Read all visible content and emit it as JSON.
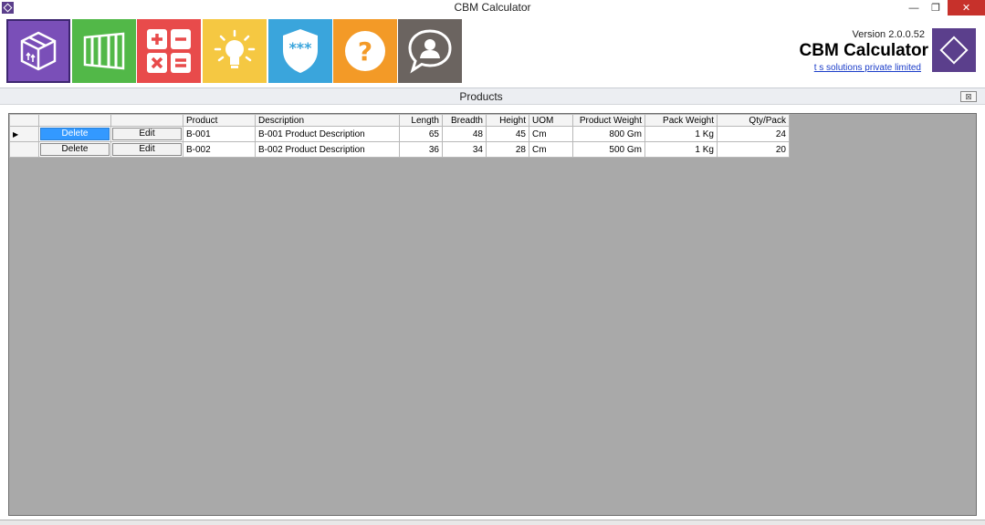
{
  "window": {
    "title": "CBM Calculator",
    "minimize": "—",
    "restore": "❐",
    "close": "✕"
  },
  "toolbar": {
    "tiles": [
      {
        "icon": "box-icon",
        "color": "#7a4fb8"
      },
      {
        "icon": "container-icon",
        "color": "#52b848"
      },
      {
        "icon": "calculator-icon",
        "color": "#e84b4b"
      },
      {
        "icon": "lightbulb-icon",
        "color": "#f5c842"
      },
      {
        "icon": "shield-password-icon",
        "color": "#3aa5dc"
      },
      {
        "icon": "help-icon",
        "color": "#f39a27"
      },
      {
        "icon": "contact-icon",
        "color": "#6b6460"
      }
    ]
  },
  "header": {
    "version": "Version 2.0.0.52",
    "brand": "CBM Calculator",
    "company": "t s solutions private limited",
    "logo_color": "#5b3f8c"
  },
  "panel": {
    "title": "Products",
    "close": "⊠"
  },
  "grid": {
    "columns": [
      "",
      "",
      "Product",
      "Description",
      "Length",
      "Breadth",
      "Height",
      "UOM",
      "Product Weight",
      "Pack Weight",
      "Qty/Pack"
    ],
    "delete_label": "Delete",
    "edit_label": "Edit",
    "selected_row_marker": "▶",
    "rows": [
      {
        "product": "B-001",
        "description": "B-001 Product Description",
        "length": "65",
        "breadth": "48",
        "height": "45",
        "uom": "Cm",
        "product_weight": "800 Gm",
        "pack_weight": "1 Kg",
        "qty_pack": "24"
      },
      {
        "product": "B-002",
        "description": "B-002 Product Description",
        "length": "36",
        "breadth": "34",
        "height": "28",
        "uom": "Cm",
        "product_weight": "500 Gm",
        "pack_weight": "1 Kg",
        "qty_pack": "20"
      }
    ]
  }
}
